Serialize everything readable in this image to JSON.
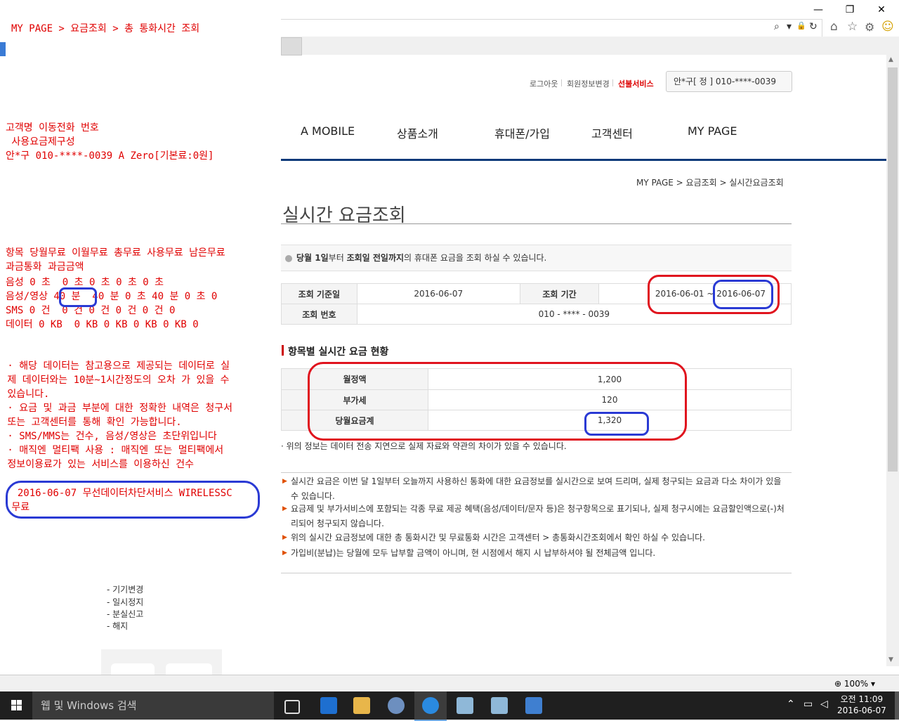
{
  "browser": {
    "window_controls": {
      "minimize": "—",
      "restore": "❐",
      "close": "✕"
    },
    "address_icons": {
      "search": "⌕",
      "dropdown": "▾",
      "lock": "🔒",
      "refresh": "↻"
    },
    "toolbar_icons": {
      "home": "⌂",
      "favorites": "☆",
      "settings": "⚙",
      "smiley": "☺"
    },
    "zoom_label": "100%"
  },
  "overlay": {
    "path": "MY PAGE > 요금조회 > 총 통화시간 조회",
    "customer_header": "고객명 이동전화 번호\n 사용요금제구성\n안*구 010-****-0039 A Zero[기본료:0원]",
    "usage_header": "항목 당월무료 이월무료 총무료 사용무료 남은무료\n과금통화 과금금액",
    "usage_rows": [
      "음성 0 초  0 초 0 초 0 초 0 초",
      "음성/영상 40 분  40 분 0 초 40 분 0 초 0",
      "SMS 0 건  0 건 0 건 0 건 0 건 0",
      "데이터 0 KB  0 KB 0 KB 0 KB 0 KB 0"
    ],
    "notes": " · 해당 데이터는 참고용으로 제공되는 데이터로 실\n 제 데이터와는 10분~1시간정도의 오차 가 있을 수\n 있습니다.\n · 요금 및 과금 부분에 대한 정확한 내역은 청구서\n 또는 고객센터를 통해 확인 가능합니다.\n · SMS/MMS는 건수, 음성/영상은 초단위입니다\n · 매직엔 멀티팩 사용 : 매직엔 또는 멀티팩에서\n 정보이용료가 있는 서비스를 이용하신 건수",
    "service_line": "  2016-06-07 무선데이터차단서비스 WIRELESSC\n 무료"
  },
  "header": {
    "logout": "로그아웃",
    "edit_member": "회원정보변경",
    "prepaid": "선불서비스",
    "user_info": "안*구[ 정 ] 010-****-0039"
  },
  "gnb": [
    "A MOBILE",
    "상품소개",
    "휴대폰/가입",
    "고객센터",
    "MY PAGE"
  ],
  "breadcrumb": "MY PAGE > 요금조회 > 실시간요금조회",
  "page_title": "실시간 요금조회",
  "info_text_pre": "당월 1일",
  "info_text_mid1": "부터 ",
  "info_text_bold2": "조회일 전일까지",
  "info_text_post": "의 휴대폰 요금을 조회 하실 수 있습니다.",
  "query": {
    "base_date_label": "조회 기준일",
    "base_date": "2016-06-07",
    "period_label": "조회 기간",
    "period_from": "2016-06-01 ~ ",
    "period_to": "2016-06-07",
    "number_label": "조회 번호",
    "number": "010 - **** - 0039"
  },
  "section_title": "항목별 실시간 요금 현황",
  "charges": [
    {
      "label": "월정액",
      "value": "1,200"
    },
    {
      "label": "부가세",
      "value": "120"
    },
    {
      "label": "당월요금계",
      "value": "1,320"
    }
  ],
  "charge_note": "· 위의 정보는 데이터 전송 지연으로 실제 자료와 약관의 차이가 있을 수 있습니다.",
  "bullets": [
    "실시간 요금은 이번 달 1일부터 오늘까지 사용하신 통화에 대한 요금정보를 실시간으로 보여 드리며, 실제 청구되는 요금과 다소 차이가 있을 수 있습니다.",
    "요금제 및 부가서비스에 포함되는 각종 무료 제공 혜택(음성/데이터/문자 등)은 청구항목으로 표기되나, 실제 청구시에는 요금할인액으로(-)처리되어 청구되지 않습니다.",
    "위의 실시간 요금정보에 대한 총 통화시간 및 무료통화 시간은 고객센터 > 총통화시간조회에서 확인 하실 수 있습니다.",
    "가입비(분납)는 당월에 모두 납부할 금액이 아니며, 현 시점에서 해지 시 납부하셔야 될 전체금액 입니다."
  ],
  "side_links": [
    "- 기기변경",
    "- 일시정지",
    "- 분실신고",
    "- 해지"
  ],
  "taskbar": {
    "search_placeholder": "웹 및 Windows 검색",
    "time": "오전 11:09",
    "date": "2016-06-07"
  }
}
